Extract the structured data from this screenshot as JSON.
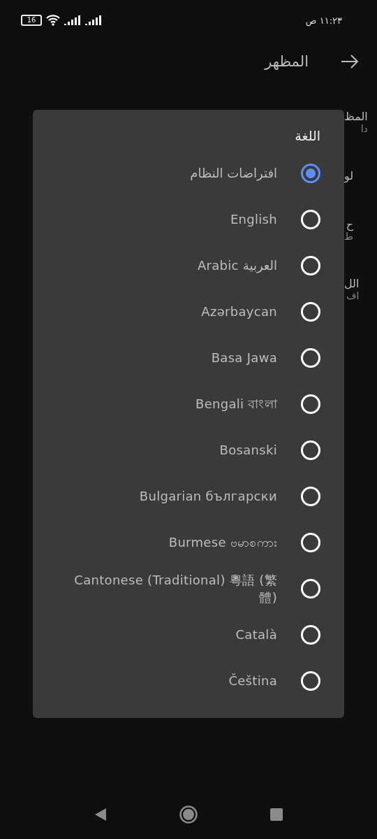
{
  "status_bar": {
    "battery": "16",
    "time": "١١:٢٣ ص"
  },
  "header": {
    "title": "المظهر"
  },
  "background_items": [
    {
      "title": "المظ",
      "subtitle": "دا"
    },
    {
      "title": "لو"
    },
    {
      "title": "ح",
      "subtitle": "ط"
    },
    {
      "title": "الل",
      "subtitle": "اف"
    }
  ],
  "dialog": {
    "title": "اللغة",
    "options": [
      {
        "label": "افتراضات النظام",
        "selected": true
      },
      {
        "label": "English",
        "selected": false
      },
      {
        "label": "Arabic العربية",
        "selected": false
      },
      {
        "label": "Azərbaycan",
        "selected": false
      },
      {
        "label": "Basa Jawa",
        "selected": false
      },
      {
        "label": "Bengali বাংলা",
        "selected": false
      },
      {
        "label": "Bosanski",
        "selected": false
      },
      {
        "label": "Bulgarian български",
        "selected": false
      },
      {
        "label": "Burmese ဗမာစကား",
        "selected": false
      },
      {
        "label": "Cantonese (Traditional) 粵語 (繁體)",
        "selected": false
      },
      {
        "label": "Català",
        "selected": false
      },
      {
        "label": "Čeština",
        "selected": false
      }
    ]
  }
}
